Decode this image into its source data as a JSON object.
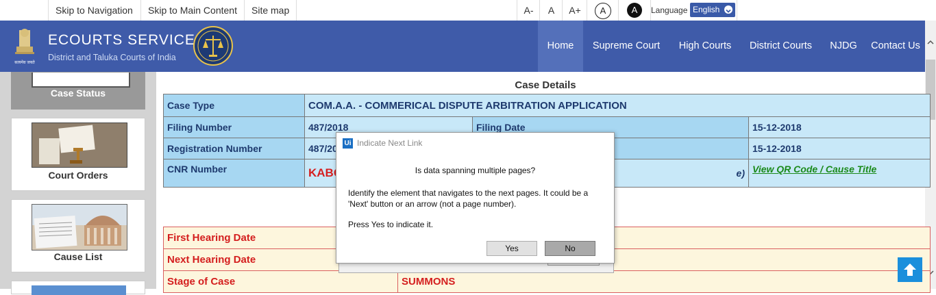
{
  "topbar": {
    "skip_navigation": "Skip to Navigation",
    "skip_main": "Skip to Main Content",
    "site_map": "Site map",
    "font_small": "A-",
    "font_normal": "A",
    "font_large": "A+",
    "contrast_light": "A",
    "contrast_dark": "A",
    "language_label": "Language",
    "language_value": "English"
  },
  "header": {
    "title": "ECOURTS SERVICES",
    "subtitle": "District and Taluka Courts of India",
    "emblem_caption": "सत्यमेव जयते",
    "nav": [
      "Home",
      "Supreme Court",
      "High Courts",
      "District Courts",
      "NJDG",
      "Contact Us"
    ]
  },
  "sidebar": {
    "items": [
      {
        "label": "Case Status"
      },
      {
        "label": "Court Orders"
      },
      {
        "label": "Cause List"
      }
    ]
  },
  "case_details": {
    "title": "Case Details",
    "case_type_label": "Case Type",
    "case_type_value": "COM.A.A. - COMMERICAL DISPUTE ARBITRATION APPLICATION",
    "filing_number_label": "Filing Number",
    "filing_number_value": "487/2018",
    "filing_date_label": "Filing Date",
    "filing_date_value": "15-12-2018",
    "registration_number_label": "Registration Number",
    "registration_number_value": "487/20",
    "registration_date_value": "15-12-2018",
    "cnr_label": "CNR Number",
    "cnr_value": "KABC",
    "cnr_suffix": "e)",
    "qr_link": "View QR Code / Cause Title"
  },
  "hearing": {
    "first_hearing_label": "First Hearing Date",
    "next_hearing_label": "Next Hearing Date",
    "stage_label": "Stage of Case",
    "stage_value": "SUMMONS"
  },
  "dialog": {
    "title": "Indicate Next Link",
    "logo": "Ui",
    "heading": "Is data spanning multiple pages?",
    "body": "Identify the element that navigates to the next pages. It could be a 'Next' button or an arrow (not a page number).",
    "instruction": "Press Yes to indicate it.",
    "yes_label": "Yes",
    "no_label": "No"
  },
  "colors": {
    "header_bg": "#3f5ba9",
    "label_cell": "#a7d7f2",
    "value_cell": "#c8e8f8",
    "hearing_bg": "#fdf6dd",
    "red_text": "#d41e1e",
    "scroll_top_btn": "#1a8fdc"
  }
}
